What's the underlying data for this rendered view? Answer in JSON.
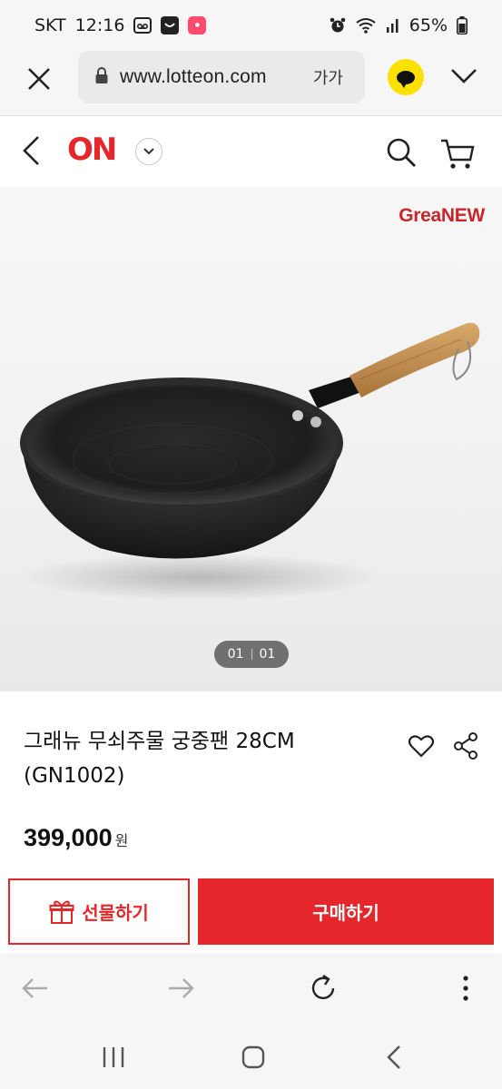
{
  "status_bar": {
    "carrier": "SKT",
    "time": "12:16",
    "battery": "65%",
    "icons": [
      "voicemail-icon",
      "dark-app-icon",
      "red-app-icon",
      "alarm-icon",
      "wifi-icon",
      "signal-icon",
      "battery-icon"
    ]
  },
  "browser": {
    "url": "www.lotteon.com",
    "text_size_label": "가가",
    "icons": [
      "close-icon",
      "lock-icon",
      "kakao-icon",
      "chevron-down-icon"
    ]
  },
  "header": {
    "logo": "ON",
    "icons": [
      "back-icon",
      "dropdown-icon",
      "search-icon",
      "cart-icon"
    ]
  },
  "gallery": {
    "brand": "GreaNEW",
    "current": "01",
    "total": "01"
  },
  "product": {
    "title": "그래뉴 무쇠주물 궁중팬 28CM (GN1002)",
    "price": "399,000",
    "price_unit": "원"
  },
  "actions": {
    "gift_label": "선물하기",
    "buy_label": "구매하기",
    "accent_color": "#e5262b"
  },
  "toolbar": {
    "icons": [
      "back-arrow-icon",
      "forward-arrow-icon",
      "refresh-icon",
      "more-icon"
    ]
  },
  "nav": {
    "icons": [
      "recents-icon",
      "home-icon",
      "back-icon"
    ]
  }
}
